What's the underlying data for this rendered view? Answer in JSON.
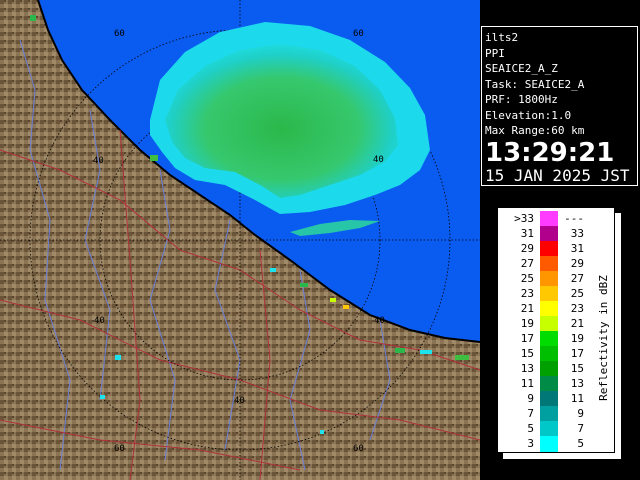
{
  "radar": {
    "site": "ilts2",
    "product": "PPI",
    "task_line": "SEAICE2_A_Z",
    "task": "Task: SEAICE2_A",
    "prf": "PRF: 1800Hz",
    "elevation": "Elevation:1.0",
    "max_range": "Max Range:60 km",
    "time": "13:29:21",
    "date": "15 JAN 2025 JST"
  },
  "range_rings": {
    "labels": [
      "40",
      "40",
      "40",
      "40",
      "40",
      "60",
      "60",
      "60",
      "60"
    ]
  },
  "legend": {
    "title": "Reflectivity in dBZ",
    "rows": [
      {
        "left": ">33",
        "right": "---",
        "color": "#ff3cff"
      },
      {
        "left": "31",
        "right": "33",
        "color": "#b0008c"
      },
      {
        "left": "29",
        "right": "31",
        "color": "#ff0000"
      },
      {
        "left": "27",
        "right": "29",
        "color": "#ff5a00"
      },
      {
        "left": "25",
        "right": "27",
        "color": "#ff9600"
      },
      {
        "left": "23",
        "right": "25",
        "color": "#ffc800"
      },
      {
        "left": "21",
        "right": "23",
        "color": "#ffff00"
      },
      {
        "left": "19",
        "right": "21",
        "color": "#c8ff00"
      },
      {
        "left": "17",
        "right": "19",
        "color": "#00dc00"
      },
      {
        "left": "15",
        "right": "17",
        "color": "#00be00"
      },
      {
        "left": "13",
        "right": "15",
        "color": "#00a000"
      },
      {
        "left": "11",
        "right": "13",
        "color": "#008c46"
      },
      {
        "left": "9",
        "right": "11",
        "color": "#007878"
      },
      {
        "left": "7",
        "right": "9",
        "color": "#00a0a0"
      },
      {
        "left": "5",
        "right": "7",
        "color": "#00c8c8"
      },
      {
        "left": "3",
        "right": "5",
        "color": "#00ffff"
      }
    ]
  }
}
